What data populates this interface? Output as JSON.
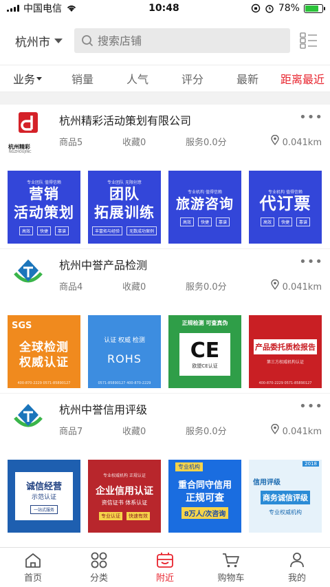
{
  "status_bar": {
    "carrier": "中国电信",
    "time": "10:48",
    "battery": "78%",
    "battery_level": 0.78
  },
  "header": {
    "city": "杭州市",
    "search_placeholder": "搜索店铺"
  },
  "sort_tabs": [
    {
      "label": "业务"
    },
    {
      "label": "销量"
    },
    {
      "label": "人气"
    },
    {
      "label": "评分"
    },
    {
      "label": "最新"
    },
    {
      "label": "距离最近",
      "active": true
    }
  ],
  "shops": [
    {
      "name": "杭州精彩活动策划有限公司",
      "logo_text": "杭州精彩",
      "logo_sub": "NGZHOUJINC",
      "products": "商品5",
      "favorites": "收藏0",
      "service": "服务0.0分",
      "distance": "0.041km",
      "thumbs": [
        {
          "top": "专业团队 值得信赖",
          "lines": [
            "营销",
            "活动策划"
          ],
          "tags": [
            "高效",
            "快捷",
            "靠谱"
          ]
        },
        {
          "top": "专业团队 无限创意",
          "lines": [
            "团队",
            "拓展训练"
          ],
          "tags": [
            "丰富拓与经验",
            "无数成功案例"
          ]
        },
        {
          "top": "专业机构 值得信赖",
          "lines": [
            "旅游咨询"
          ],
          "tags": [
            "高效",
            "快捷",
            "靠谱"
          ]
        },
        {
          "top": "专业机构 值得信赖",
          "lines": [
            "代订票"
          ],
          "tags": [
            "高效",
            "快捷",
            "靠谱"
          ]
        }
      ]
    },
    {
      "name": "杭州中誉产品检测",
      "products": "商品4",
      "favorites": "收藏0",
      "service": "服务0.0分",
      "distance": "0.041km",
      "thumbs": [
        {
          "badge": "SGS",
          "lines": [
            "全球检测",
            "权威认证"
          ],
          "foot": "400-870-2229  0571-85890127"
        },
        {
          "top": "认证 权威 检测",
          "lines": [
            "ROHS"
          ],
          "foot": "0571-85890127 400-870-2229"
        },
        {
          "top": "正规检测 可查真伪",
          "lines": [
            "CE"
          ],
          "sub": "欧盟CE认证"
        },
        {
          "lines": [
            "产品委托质检报告"
          ],
          "sub": "第三方权威机构认证",
          "foot": "400-870-2229  0571-85890127"
        }
      ]
    },
    {
      "name": "杭州中誉信用评级",
      "products": "商品7",
      "favorites": "收藏0",
      "service": "服务0.0分",
      "distance": "0.041km",
      "thumbs": [
        {
          "lines": [
            "诚信经营",
            "示范认证"
          ],
          "sub": "一站式服务"
        },
        {
          "top": "专业权威机构 正规认证",
          "lines": [
            "企业信用认证"
          ],
          "sub": "资信证书  体系认证",
          "tags": [
            "专业认证",
            "快速有效"
          ]
        },
        {
          "top": "专业机构",
          "lines": [
            "重合同守信用",
            "正规可查"
          ],
          "sub": "8万人/次咨询"
        },
        {
          "top": "2018",
          "lines": [
            "信用评级",
            "商务诚信评级"
          ],
          "sub": "专业权威机构"
        }
      ]
    }
  ],
  "bottom_nav": [
    {
      "label": "首页",
      "icon": "home-icon"
    },
    {
      "label": "分类",
      "icon": "category-icon"
    },
    {
      "label": "附近",
      "icon": "nearby-icon",
      "active": true
    },
    {
      "label": "购物车",
      "icon": "cart-icon"
    },
    {
      "label": "我的",
      "icon": "profile-icon"
    }
  ],
  "colors": {
    "accent": "#e8232d",
    "thumb_blue": "#3346d9"
  }
}
